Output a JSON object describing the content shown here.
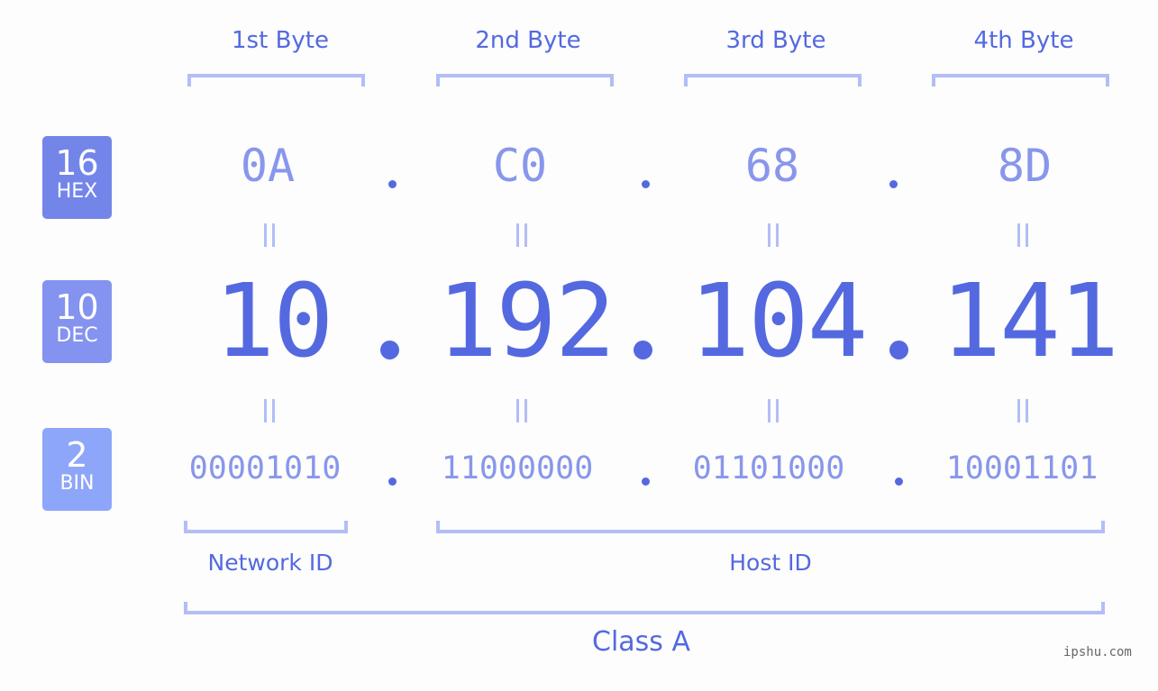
{
  "byte_headers": [
    "1st Byte",
    "2nd Byte",
    "3rd Byte",
    "4th Byte"
  ],
  "badges": {
    "hex": {
      "num": "16",
      "unit": "HEX",
      "color": "#7485ea"
    },
    "dec": {
      "num": "10",
      "unit": "DEC",
      "color": "#8493ef"
    },
    "bin": {
      "num": "2",
      "unit": "BIN",
      "color": "#8ea6f9"
    }
  },
  "hex": [
    "0A",
    "C0",
    "68",
    "8D"
  ],
  "dec": [
    "10",
    "192",
    "104",
    "141"
  ],
  "bin": [
    "00001010",
    "11000000",
    "01101000",
    "10001101"
  ],
  "labels": {
    "network_id": "Network ID",
    "host_id": "Host ID",
    "class": "Class A"
  },
  "watermark": "ipshu.com",
  "colors": {
    "primary": "#5469e0",
    "secondary": "#8896ec",
    "bracket": "#b3bdf6"
  }
}
